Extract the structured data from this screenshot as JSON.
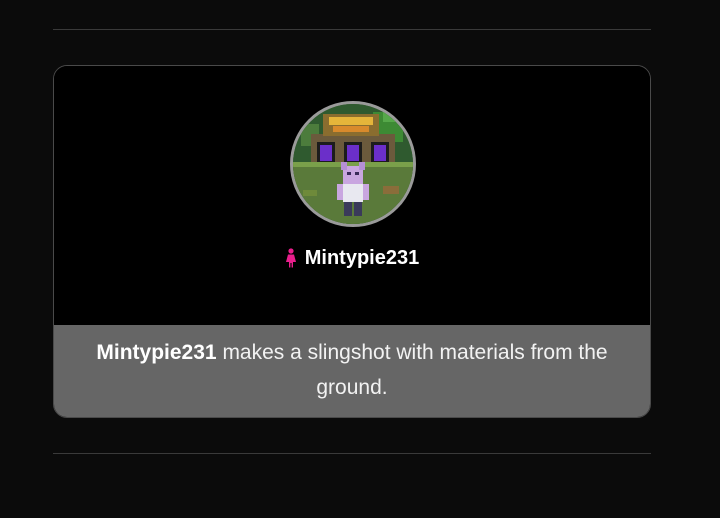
{
  "card": {
    "player_name": "Mintypie231",
    "gender_icon": "female-icon",
    "avatar_icon": "minecraft-skin-avatar",
    "caption": {
      "subject": "Mintypie231",
      "text": " makes a slingshot with materials from the ground."
    }
  },
  "colors": {
    "background": "#0b0b0b",
    "card_top": "#000000",
    "caption_bg": "#666666",
    "gender_icon": "#e91e8c"
  }
}
